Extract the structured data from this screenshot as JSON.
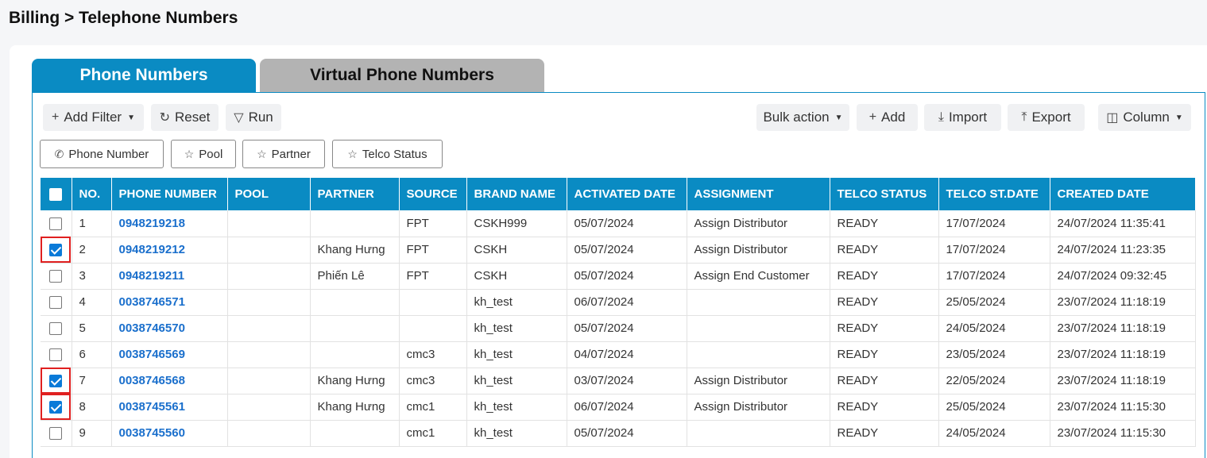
{
  "breadcrumb": "Billing > Telephone Numbers",
  "tabs": [
    {
      "label": "Phone Numbers",
      "active": true
    },
    {
      "label": "Virtual Phone Numbers",
      "active": false
    }
  ],
  "toolbar": {
    "add_filter": "Add Filter",
    "reset": "Reset",
    "run": "Run",
    "bulk_action": "Bulk action",
    "add": "Add",
    "import": "Import",
    "export": "Export",
    "column": "Column"
  },
  "filters": [
    "Phone Number",
    "Pool",
    "Partner",
    "Telco Status"
  ],
  "table": {
    "headers": [
      "NO.",
      "PHONE NUMBER",
      "POOL",
      "PARTNER",
      "SOURCE",
      "BRAND NAME",
      "ACTIVATED DATE",
      "ASSIGNMENT",
      "TELCO STATUS",
      "TELCO ST.DATE",
      "CREATED DATE"
    ],
    "rows": [
      {
        "checked": false,
        "no": "1",
        "phone": "0948219218",
        "pool": "",
        "partner": "",
        "source": "FPT",
        "brand": "CSKH999",
        "activated": "05/07/2024",
        "assignment": "Assign Distributor",
        "telco_status": "READY",
        "telco_date": "17/07/2024",
        "created": "24/07/2024 11:35:41"
      },
      {
        "checked": true,
        "no": "2",
        "phone": "0948219212",
        "pool": "",
        "partner": "Khang Hưng",
        "source": "FPT",
        "brand": "CSKH",
        "activated": "05/07/2024",
        "assignment": "Assign Distributor",
        "telco_status": "READY",
        "telco_date": "17/07/2024",
        "created": "24/07/2024 11:23:35"
      },
      {
        "checked": false,
        "no": "3",
        "phone": "0948219211",
        "pool": "",
        "partner": "Phiến Lê",
        "source": "FPT",
        "brand": "CSKH",
        "activated": "05/07/2024",
        "assignment": "Assign End Customer",
        "telco_status": "READY",
        "telco_date": "17/07/2024",
        "created": "24/07/2024 09:32:45"
      },
      {
        "checked": false,
        "no": "4",
        "phone": "0038746571",
        "pool": "",
        "partner": "",
        "source": "",
        "brand": "kh_test",
        "activated": "06/07/2024",
        "assignment": "",
        "telco_status": "READY",
        "telco_date": "25/05/2024",
        "created": "23/07/2024 11:18:19"
      },
      {
        "checked": false,
        "no": "5",
        "phone": "0038746570",
        "pool": "",
        "partner": "",
        "source": "",
        "brand": "kh_test",
        "activated": "05/07/2024",
        "assignment": "",
        "telco_status": "READY",
        "telco_date": "24/05/2024",
        "created": "23/07/2024 11:18:19"
      },
      {
        "checked": false,
        "no": "6",
        "phone": "0038746569",
        "pool": "",
        "partner": "",
        "source": "cmc3",
        "brand": "kh_test",
        "activated": "04/07/2024",
        "assignment": "",
        "telco_status": "READY",
        "telco_date": "23/05/2024",
        "created": "23/07/2024 11:18:19"
      },
      {
        "checked": true,
        "no": "7",
        "phone": "0038746568",
        "pool": "",
        "partner": "Khang Hưng",
        "source": "cmc3",
        "brand": "kh_test",
        "activated": "03/07/2024",
        "assignment": "Assign Distributor",
        "telco_status": "READY",
        "telco_date": "22/05/2024",
        "created": "23/07/2024 11:18:19"
      },
      {
        "checked": true,
        "no": "8",
        "phone": "0038745561",
        "pool": "",
        "partner": "Khang Hưng",
        "source": "cmc1",
        "brand": "kh_test",
        "activated": "06/07/2024",
        "assignment": "Assign Distributor",
        "telco_status": "READY",
        "telco_date": "25/05/2024",
        "created": "23/07/2024 11:15:30"
      },
      {
        "checked": false,
        "no": "9",
        "phone": "0038745560",
        "pool": "",
        "partner": "",
        "source": "cmc1",
        "brand": "kh_test",
        "activated": "05/07/2024",
        "assignment": "",
        "telco_status": "READY",
        "telco_date": "24/05/2024",
        "created": "23/07/2024 11:15:30"
      }
    ]
  }
}
